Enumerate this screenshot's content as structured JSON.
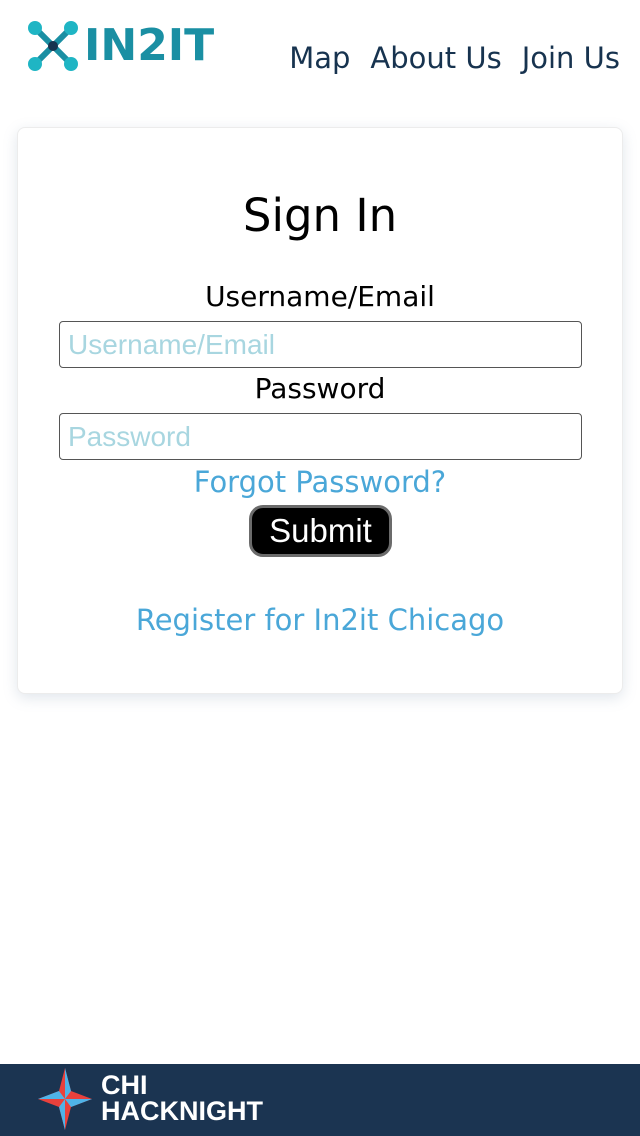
{
  "header": {
    "logo_text": "IN2IT",
    "nav": [
      {
        "label": "Map"
      },
      {
        "label": "About Us"
      },
      {
        "label": "Join Us"
      }
    ]
  },
  "signin": {
    "title": "Sign In",
    "username_label": "Username/Email",
    "username_placeholder": "Username/Email",
    "username_value": "",
    "password_label": "Password",
    "password_placeholder": "Password",
    "password_value": "",
    "forgot_link": "Forgot Password?",
    "submit_label": "Submit",
    "register_link": "Register for In2it Chicago"
  },
  "footer": {
    "brand_line1": "CHI",
    "brand_line2": "HACKNIGHT"
  },
  "colors": {
    "nav_text": "#17334f",
    "link": "#4aa7d8",
    "placeholder": "#a8d6e0",
    "footer_bg": "#1b3451",
    "logo_teal": "#1a8fa3"
  },
  "icons": {
    "logo": "in2it-logo-icon",
    "footer": "chicago-star-icon"
  }
}
